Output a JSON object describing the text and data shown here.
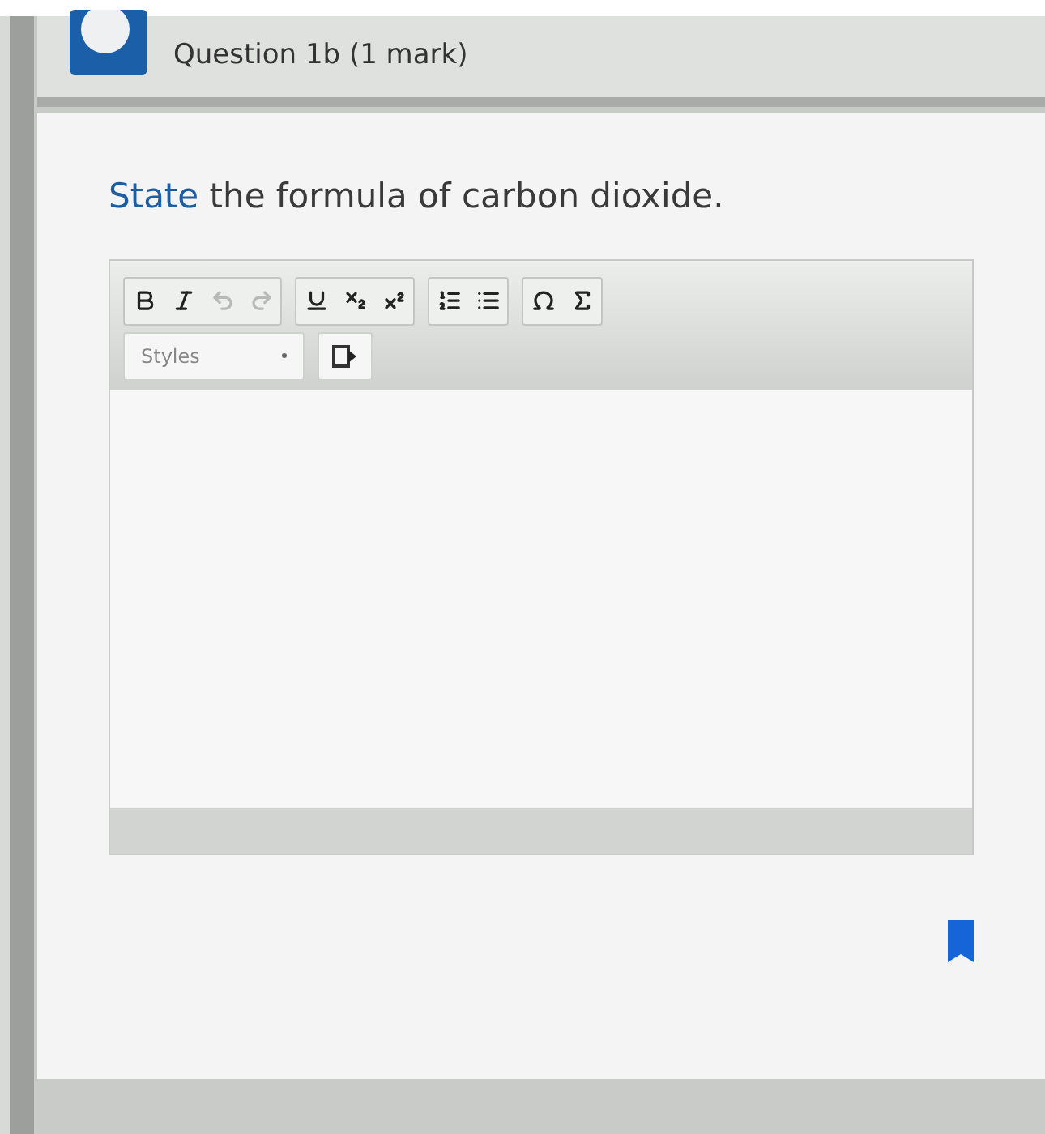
{
  "question": {
    "title": "Question 1b (1 mark)"
  },
  "prompt": "**State** the formula of carbon dioxide.",
  "editor": {
    "toolbar_groups": [
      [
        {
          "kind": "bold",
          "disabled": false
        },
        {
          "kind": "italic",
          "disabled": false
        },
        {
          "kind": "undo",
          "disabled": true
        },
        {
          "kind": "redo",
          "disabled": true
        }
      ],
      [
        {
          "kind": "underline",
          "disabled": false
        },
        {
          "kind": "subscript",
          "disabled": false
        },
        {
          "kind": "superscript",
          "disabled": false
        }
      ],
      [
        {
          "kind": "numbered-list",
          "disabled": false
        },
        {
          "kind": "bulleted-list",
          "disabled": false
        }
      ],
      [
        {
          "kind": "omega",
          "disabled": false
        },
        {
          "kind": "sigma",
          "disabled": false
        }
      ]
    ],
    "styles_dropdown": {
      "placeholder": "Styles"
    }
  },
  "flagged": true
}
